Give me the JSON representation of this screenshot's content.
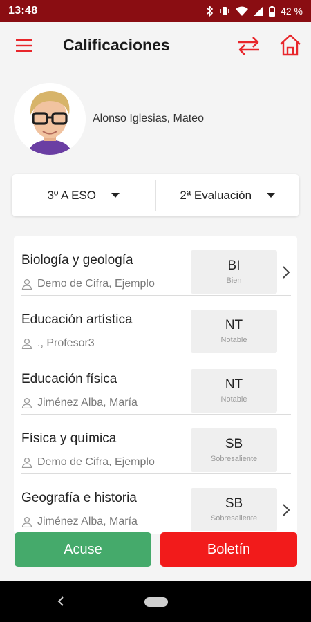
{
  "status_bar": {
    "time": "13:48",
    "battery": "42 %"
  },
  "app_bar": {
    "title": "Calificaciones"
  },
  "student": {
    "name": "Alonso Iglesias, Mateo"
  },
  "selectors": {
    "group": "3º A ESO",
    "evaluation": "2ª Evaluación"
  },
  "subjects": [
    {
      "name": "Biología y geología",
      "teacher": "Demo de Cifra, Ejemplo",
      "grade": "BI",
      "grade_label": "Bien",
      "has_detail": true
    },
    {
      "name": "Educación artística",
      "teacher": "., Profesor3",
      "grade": "NT",
      "grade_label": "Notable",
      "has_detail": false
    },
    {
      "name": "Educación física",
      "teacher": "Jiménez Alba, María",
      "grade": "NT",
      "grade_label": "Notable",
      "has_detail": false
    },
    {
      "name": "Física y química",
      "teacher": "Demo de Cifra, Ejemplo",
      "grade": "SB",
      "grade_label": "Sobresaliente",
      "has_detail": false
    },
    {
      "name": "Geografía e historia",
      "teacher": "Jiménez Alba, María",
      "grade": "SB",
      "grade_label": "Sobresaliente",
      "has_detail": true
    }
  ],
  "actions": {
    "acuse_label": "Acuse",
    "boletin_label": "Boletín"
  },
  "colors": {
    "status_bar": "#8a0d12",
    "accent_red": "#e8262b",
    "acuse_green": "#45aa6b",
    "boletin_red": "#f21b1b"
  },
  "icons": {
    "menu": "hamburger-menu-icon",
    "swap": "swap-arrows-icon",
    "home": "home-icon",
    "teacher": "person-icon",
    "chevron": "chevron-right-icon"
  }
}
